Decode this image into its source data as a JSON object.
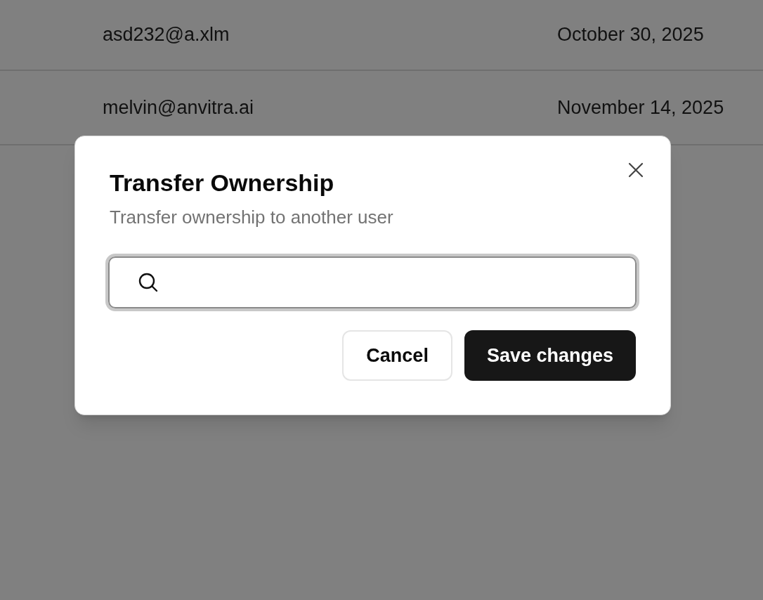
{
  "table": {
    "rows": [
      {
        "email": "asd232@a.xlm",
        "date": "October 30, 2025"
      },
      {
        "email": "melvin@anvitra.ai",
        "date": "November 14, 2025"
      }
    ]
  },
  "dialog": {
    "title": "Transfer Ownership",
    "description": "Transfer ownership to another user",
    "buttons": [
      {
        "label": "Cancel",
        "kind": "secondary"
      },
      {
        "label": "Save changes",
        "kind": "primary"
      }
    ]
  }
}
